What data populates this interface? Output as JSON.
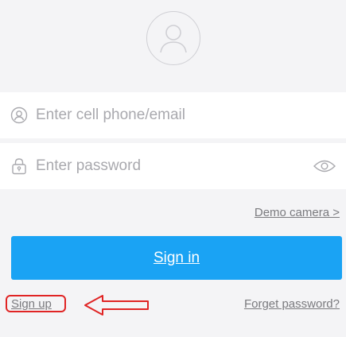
{
  "login": {
    "phone_placeholder": "Enter cell phone/email",
    "password_placeholder": "Enter password",
    "demo_link": "Demo camera >",
    "signin_label": "Sign in",
    "signup_label": "Sign up",
    "forget_label": "Forget password?"
  },
  "icons": {
    "avatar": "user-avatar-icon",
    "user": "user-icon",
    "lock": "lock-icon",
    "eye": "eye-icon",
    "annotation": "left-arrow-icon"
  },
  "colors": {
    "accent": "#1aa3f4",
    "annotation": "#e02424",
    "background": "#f4f4f6"
  }
}
